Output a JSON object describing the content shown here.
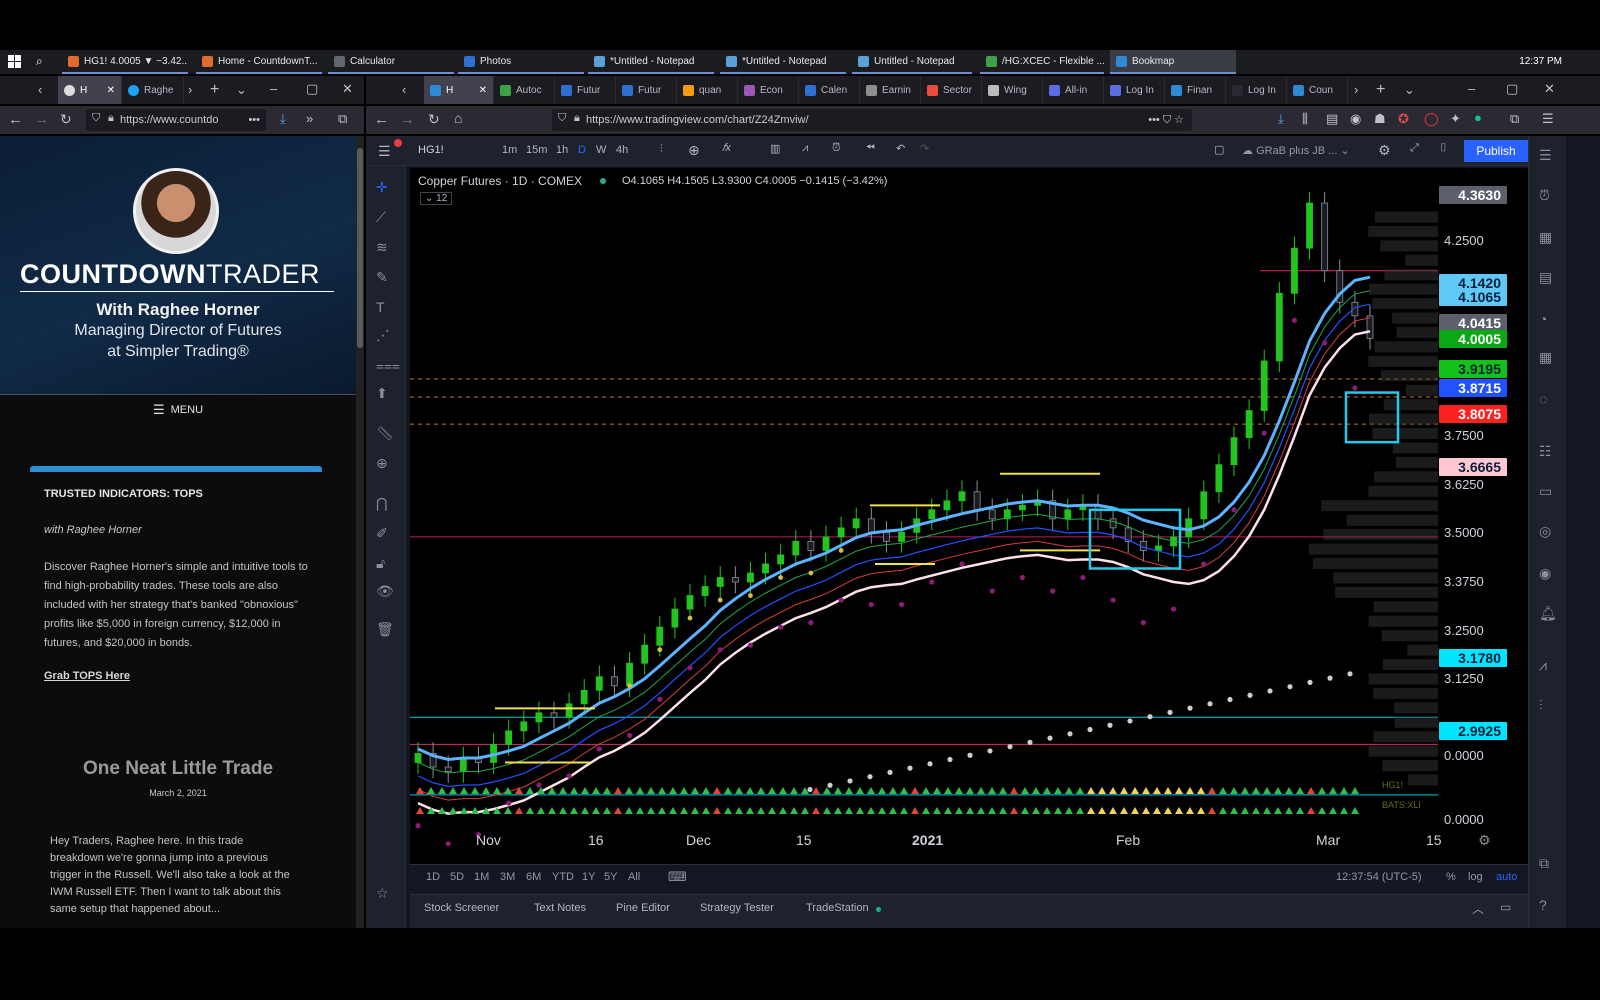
{
  "taskbar": {
    "clock": "12:37 PM",
    "apps": [
      {
        "label": "HG1! 4.0005 ▼ −3.42...",
        "color": "#e06b2b"
      },
      {
        "label": "Home - CountdownT...",
        "color": "#e06b2b"
      },
      {
        "label": "Calculator",
        "color": "#606770"
      },
      {
        "label": "Photos",
        "color": "#2f6fd1"
      },
      {
        "label": "*Untitled - Notepad",
        "color": "#5aa0d8"
      },
      {
        "label": "*Untitled - Notepad",
        "color": "#5aa0d8"
      },
      {
        "label": "Untitled - Notepad",
        "color": "#5aa0d8"
      },
      {
        "label": "/HG:XCEC - Flexible ...",
        "color": "#3fa04a"
      },
      {
        "label": "Bookmap",
        "color": "#2f8ad6"
      }
    ]
  },
  "left_browser": {
    "tabs": [
      "H",
      "Raghe"
    ],
    "url": "https://www.countdo",
    "site": {
      "brand_bold": "COUNTDOWN",
      "brand_light": "TRADER",
      "with": "With Raghee Horner",
      "role_line1": "Managing Director of Futures",
      "role_line2": "at Simpler Trading®",
      "menu": "MENU",
      "card_title": "TRUSTED INDICATORS: TOPS",
      "card_byline": "with Raghee Horner",
      "card_body": "Discover Raghee Horner's simple and intuitive tools to find high-probability trades. These tools are also included with her strategy that's banked \"obnoxious\" profits like $5,000 in foreign currency, $12,000 in futures, and $20,000 in bonds.",
      "card_link": "Grab TOPS Here",
      "post_title": "One Neat Little Trade",
      "post_date": "March 2, 2021",
      "post_body": "Hey Traders, Raghee here.  In this trade breakdown we're gonna jump into a previous trigger in the Russell.  We'll also take a look at the IWM Russell ETF. Then I want to talk about this same setup that happened about..."
    }
  },
  "right_browser": {
    "tabs": [
      "H",
      "Autoc",
      "Futur",
      "Futur",
      "quan",
      "Econ",
      "Calen",
      "Earnin",
      "Sector",
      "Wing",
      "All-in",
      "Log In",
      "Finan",
      "Log In",
      "Coun"
    ],
    "url": "https://www.tradingview.com/chart/Z24Zmviw/"
  },
  "tradingview": {
    "symbol": "HG1!",
    "intervals": [
      "1m",
      "15m",
      "1h",
      "D",
      "W",
      "4h"
    ],
    "active_interval": "D",
    "layout_name": "GRaB plus JB ...",
    "publish": "Publish",
    "legend_title": "Copper Futures · 1D · COMEX",
    "ohlc": "O4.1065 H4.1505 L3.9300 C4.0005 −0.1415 (−3.42%)",
    "indicators_count": "12",
    "lower_pane_labels": [
      "HG1!",
      "BATS:XLI"
    ],
    "range_buttons": [
      "1D",
      "5D",
      "1M",
      "3M",
      "6M",
      "YTD",
      "1Y",
      "5Y",
      "All"
    ],
    "time_readout": "12:37:54 (UTC-5)",
    "scale_options": [
      "%",
      "log",
      "auto"
    ],
    "bottom_tabs": [
      "Stock Screener",
      "Text Notes",
      "Pine Editor",
      "Strategy Tester",
      "TradeStation"
    ],
    "colors": {
      "up": "#22c41e",
      "down": "#2d2f36",
      "accent": "#2962ff",
      "bg": "#000000"
    }
  },
  "chart_data": {
    "type": "candlestick",
    "title": "Copper Futures · 1D · COMEX",
    "x_tick_labels": [
      "Nov",
      "16",
      "Dec",
      "15",
      "2021",
      "Feb",
      "Mar",
      "15"
    ],
    "y_tick_labels": [
      "4.2500",
      "3.7500",
      "3.6250",
      "3.5000",
      "3.3750",
      "3.2500",
      "3.1250",
      "0.0000",
      "0.0000"
    ],
    "y_range": [
      3.03,
      4.36
    ],
    "price_tags": [
      {
        "value": "4.3630",
        "color": "#5d606b",
        "text": "#ffffff"
      },
      {
        "value": "4.1420",
        "color": "#5fc8f5",
        "text": "#0b1e3a"
      },
      {
        "value": "4.1065",
        "color": "#5fc8f5",
        "text": "#0b1e3a"
      },
      {
        "value": "4.0415",
        "color": "#5d606b",
        "text": "#ffffff"
      },
      {
        "value": "4.0005",
        "color": "#0aa815",
        "text": "#ffffff"
      },
      {
        "value": "3.9195",
        "color": "#12c21b",
        "text": "#0b1e3a"
      },
      {
        "value": "3.8715",
        "color": "#2152ff",
        "text": "#ffffff"
      },
      {
        "value": "3.8075",
        "color": "#ff2020",
        "text": "#ffffff"
      },
      {
        "value": "3.6665",
        "color": "#ffc7d2",
        "text": "#0b1e3a"
      },
      {
        "value": "3.1780",
        "color": "#00e5ff",
        "text": "#0b1e3a"
      },
      {
        "value": "2.9925",
        "color": "#00e5ff",
        "text": "#0b1e3a"
      }
    ],
    "candles_approx_close": [
      3.08,
      3.05,
      3.04,
      3.07,
      3.06,
      3.1,
      3.13,
      3.15,
      3.17,
      3.16,
      3.19,
      3.22,
      3.25,
      3.23,
      3.28,
      3.32,
      3.36,
      3.4,
      3.43,
      3.45,
      3.47,
      3.46,
      3.48,
      3.5,
      3.52,
      3.55,
      3.53,
      3.56,
      3.58,
      3.6,
      3.57,
      3.55,
      3.57,
      3.6,
      3.62,
      3.64,
      3.66,
      3.62,
      3.6,
      3.62,
      3.63,
      3.64,
      3.6,
      3.62,
      3.63,
      3.6,
      3.58,
      3.55,
      3.53,
      3.54,
      3.56,
      3.6,
      3.66,
      3.72,
      3.78,
      3.84,
      3.95,
      4.1,
      4.2,
      4.3,
      4.15,
      4.08,
      4.05,
      4.0
    ]
  }
}
